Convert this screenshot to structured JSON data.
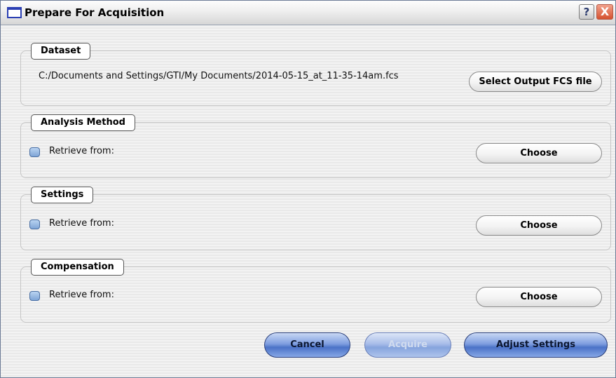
{
  "window": {
    "title": "Prepare For Acquisition",
    "help_label": "?",
    "close_label": "X"
  },
  "dataset": {
    "legend": "Dataset",
    "path": "C:/Documents and Settings/GTI/My Documents/2014-05-15_at_11-35-14am.fcs",
    "select_label": "Select Output FCS file"
  },
  "analysis_method": {
    "legend": "Analysis Method",
    "checkbox_label": "Retrieve from:",
    "checked": false,
    "choose_label": "Choose"
  },
  "settings": {
    "legend": "Settings",
    "checkbox_label": "Retrieve from:",
    "checked": false,
    "choose_label": "Choose"
  },
  "compensation": {
    "legend": "Compensation",
    "checkbox_label": "Retrieve from:",
    "checked": false,
    "choose_label": "Choose"
  },
  "footer": {
    "cancel_label": "Cancel",
    "acquire_label": "Acquire",
    "acquire_enabled": false,
    "adjust_label": "Adjust Settings"
  },
  "colors": {
    "primary_button": "#4b72c7",
    "title_icon": "#2b3fb3",
    "close_button": "#d5512f"
  }
}
